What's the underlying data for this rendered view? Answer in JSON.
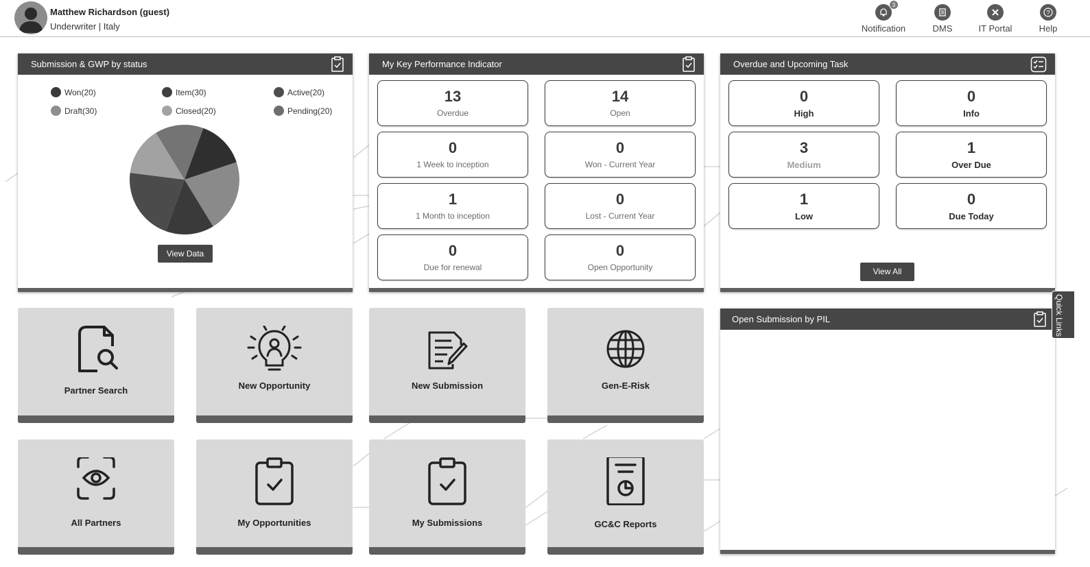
{
  "header": {
    "user_name": "Matthew Richardson (guest)",
    "user_role": "Underwriter | Italy",
    "notification_label": "Notification",
    "notification_count": "3",
    "dms_label": "DMS",
    "it_portal_label": "IT Portal",
    "help_label": "Help"
  },
  "submission_panel": {
    "title": "Submission & GWP by status",
    "view_button": "View Data",
    "legend": [
      {
        "label": "Won(20)",
        "color": "#3a3a3a"
      },
      {
        "label": "Item(30)",
        "color": "#3f3f3f"
      },
      {
        "label": "Active(20)",
        "color": "#4d4d4d"
      },
      {
        "label": "Draft(30)",
        "color": "#8e8e8e"
      },
      {
        "label": "Closed(20)",
        "color": "#a3a3a3"
      },
      {
        "label": "Pending(20)",
        "color": "#6e6e6e"
      }
    ]
  },
  "chart_data": {
    "type": "pie",
    "categories": [
      "Won",
      "Item",
      "Active",
      "Draft",
      "Closed",
      "Pending"
    ],
    "values": [
      20,
      30,
      20,
      30,
      20,
      20
    ],
    "colors": [
      "#2f2f2f",
      "#8a8a8a",
      "#3a3a3a",
      "#4b4b4b",
      "#a2a2a2",
      "#747474"
    ]
  },
  "kpi_panel": {
    "title": "My Key Performance Indicator",
    "items": [
      {
        "value": "13",
        "label": "Overdue"
      },
      {
        "value": "14",
        "label": "Open"
      },
      {
        "value": "0",
        "label": "1 Week to inception"
      },
      {
        "value": "0",
        "label": "Won - Current Year"
      },
      {
        "value": "1",
        "label": "1 Month to inception"
      },
      {
        "value": "0",
        "label": "Lost - Current Year"
      },
      {
        "value": "0",
        "label": "Due for renewal"
      },
      {
        "value": "0",
        "label": "Open Opportunity"
      }
    ]
  },
  "task_panel": {
    "title": "Overdue and Upcoming Task",
    "view_button": "View All",
    "items": [
      {
        "value": "0",
        "label": "High"
      },
      {
        "value": "0",
        "label": "Info"
      },
      {
        "value": "3",
        "label": "Medium"
      },
      {
        "value": "1",
        "label": "Over Due"
      },
      {
        "value": "1",
        "label": "Low"
      },
      {
        "value": "0",
        "label": "Due Today"
      }
    ]
  },
  "pil_panel": {
    "title": "Open Submission by PIL"
  },
  "tiles": [
    {
      "label": "Partner Search",
      "icon": "document-search-icon"
    },
    {
      "label": "New Opportunity",
      "icon": "lightbulb-person-icon"
    },
    {
      "label": "New Submission",
      "icon": "document-edit-icon"
    },
    {
      "label": "Gen-E-Risk",
      "icon": "globe-icon"
    },
    {
      "label": "All Partners",
      "icon": "eye-scan-icon"
    },
    {
      "label": "My Opportunities",
      "icon": "clipboard-check-icon"
    },
    {
      "label": "My Submissions",
      "icon": "clipboard-check-icon"
    },
    {
      "label": "GC&C Reports",
      "icon": "report-chart-icon"
    }
  ],
  "quick_links_label": "Quick Links"
}
